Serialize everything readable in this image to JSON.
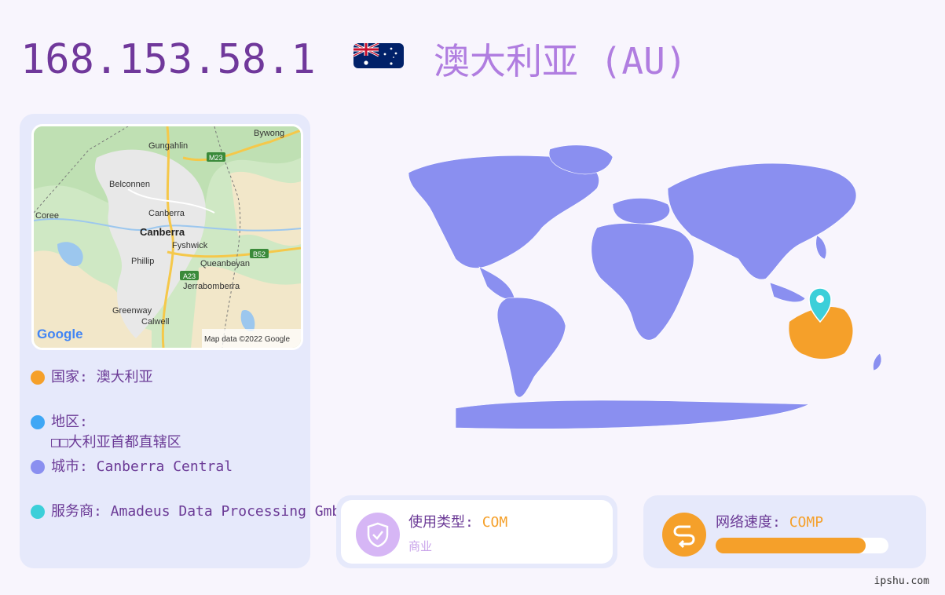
{
  "header": {
    "ip": "168.153.58.1",
    "country_title": "澳大利亚 (AU)"
  },
  "map": {
    "labels": {
      "bywong": "Bywong",
      "gungahlin": "Gungahlin",
      "m23": "M23",
      "belconnen": "Belconnen",
      "coree": "Coree",
      "canberra_small": "Canberra",
      "canberra": "Canberra",
      "fyshwick": "Fyshwick",
      "b52": "B52",
      "phillip": "Phillip",
      "queanbeyan": "Queanbeyan",
      "a23": "A23",
      "jerrabomberra": "Jerrabomberra",
      "greenway": "Greenway",
      "calwell": "Calwell"
    },
    "google_logo": "Google",
    "attribution": "Map data ©2022 Google"
  },
  "info": {
    "country": "国家: 澳大利亚",
    "region_label": "地区:",
    "region_value": "□□大利亚首都直辖区",
    "city": "城市: Canberra Central",
    "isp": "服务商: Amadeus Data Processing GmbH"
  },
  "usage": {
    "label": "使用类型: ",
    "value": "COM",
    "sub": "商业"
  },
  "speed": {
    "label": "网络速度: ",
    "value": "COMP",
    "progress": 0.87
  },
  "footer": "ipshu.com",
  "colors": {
    "country_dot": "#f5a02a",
    "region_dot": "#3fa7f5",
    "city_dot": "#8a8ff0",
    "isp_dot": "#3ccfd9",
    "world": "#8a8ff0",
    "highlight": "#f5a02a",
    "pin": "#3ccfd9"
  }
}
